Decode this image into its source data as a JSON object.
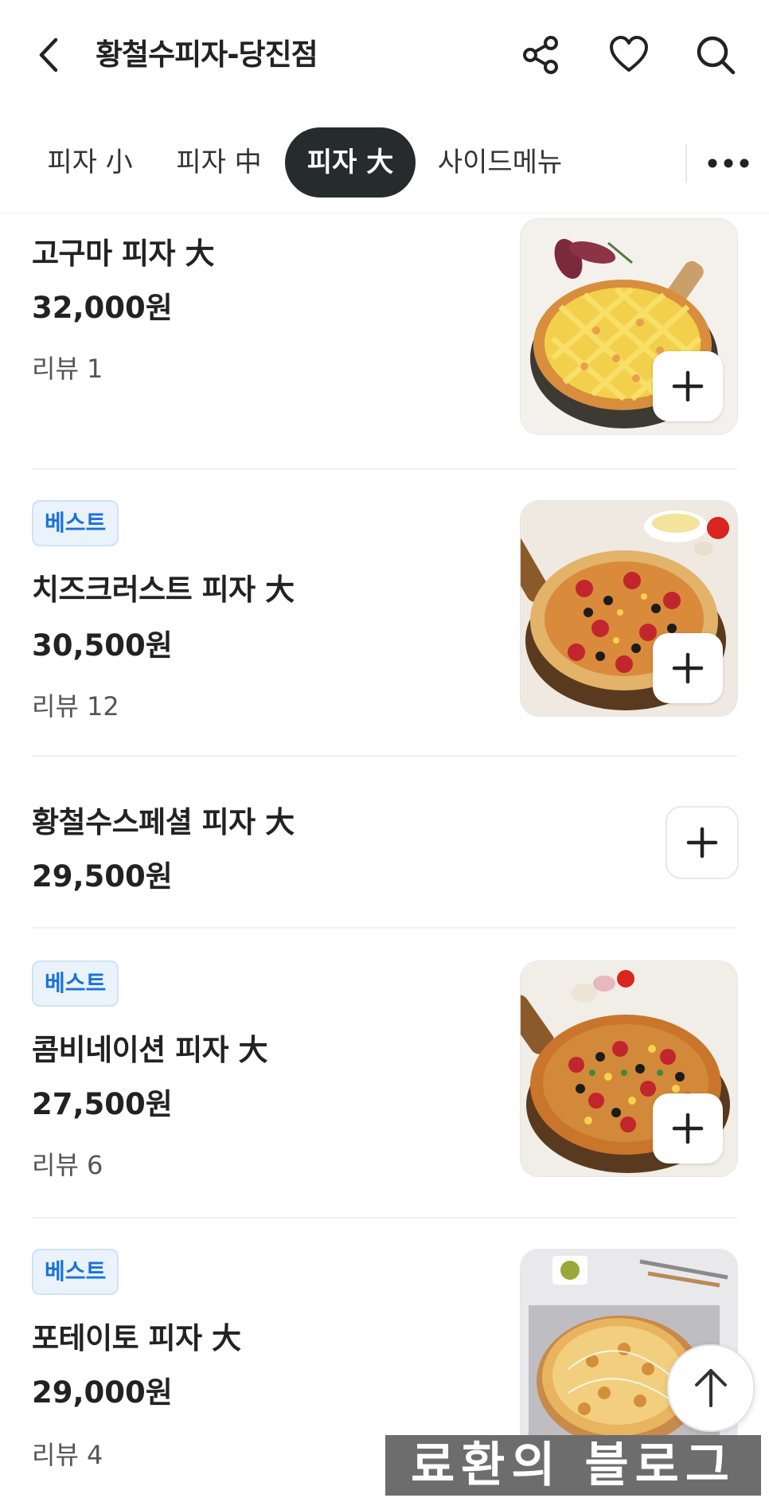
{
  "header": {
    "title": "황철수피자-당진점",
    "back_icon": "chevron-left-icon",
    "share_icon": "share-icon",
    "favorite_icon": "heart-icon",
    "search_icon": "search-icon"
  },
  "tabs": [
    {
      "label": "피자 小",
      "active": false
    },
    {
      "label": "피자 中",
      "active": false
    },
    {
      "label": "피자 大",
      "active": true
    },
    {
      "label": "사이드메뉴",
      "active": false
    }
  ],
  "more_icon": "more-dots-icon",
  "menu": [
    {
      "badge": "",
      "name": "고구마 피자 大",
      "price": "32,000원",
      "review": "리뷰 1",
      "has_image": true
    },
    {
      "badge": "베스트",
      "name": "치즈크러스트 피자 大",
      "price": "30,500원",
      "review": "리뷰 12",
      "has_image": true
    },
    {
      "badge": "",
      "name": "황철수스페셜 피자 大",
      "price": "29,500원",
      "review": "",
      "has_image": false
    },
    {
      "badge": "베스트",
      "name": "콤비네이션 피자 大",
      "price": "27,500원",
      "review": "리뷰 6",
      "has_image": true
    },
    {
      "badge": "베스트",
      "name": "포테이토 피자 大",
      "price": "29,000원",
      "review": "리뷰 4",
      "has_image": true
    }
  ],
  "watermark": "료환의 블로그",
  "colors": {
    "active_tab_bg": "#262b2b",
    "badge_text": "#1a73d9",
    "badge_bg": "#eaf3fb"
  }
}
